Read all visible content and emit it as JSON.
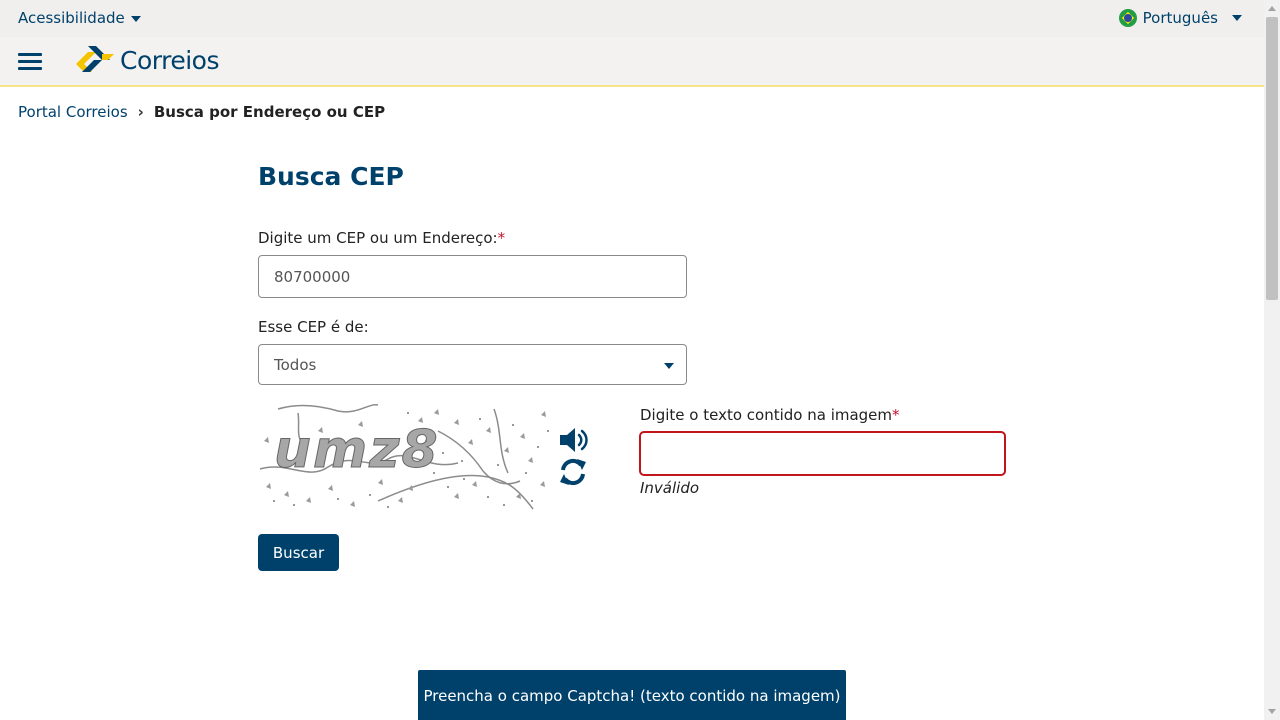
{
  "topbar": {
    "accessibility_label": "Acessibilidade",
    "language_label": "Português"
  },
  "header": {
    "brand": "Correios"
  },
  "breadcrumb": {
    "home": "Portal Correios",
    "separator": "›",
    "current": "Busca por Endereço ou CEP"
  },
  "form": {
    "title": "Busca CEP",
    "cep_label": "Digite um CEP ou um Endereço:",
    "required_mark": "*",
    "cep_value": "80700000",
    "type_label": "Esse CEP é de:",
    "type_selected": "Todos",
    "captcha_label": "Digite o texto contido na imagem",
    "captcha_value": "",
    "captcha_error": "Inválido",
    "captcha_image_text": "umz8",
    "submit_label": "Buscar"
  },
  "toast": {
    "message": "Preencha o campo Captcha! (texto contido na imagem)"
  },
  "colors": {
    "brand_blue": "#00416b",
    "brand_yellow": "#f5c400",
    "error_red": "#c0151b"
  }
}
